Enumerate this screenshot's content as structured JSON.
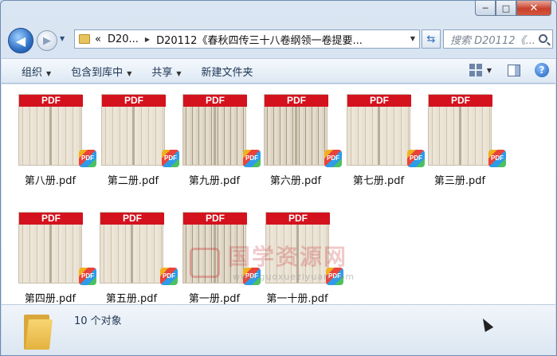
{
  "window": {
    "min_label": "─",
    "max_label": "□",
    "close_label": "✕"
  },
  "nav": {
    "back_glyph": "◀",
    "forward_glyph": "▶",
    "dropdown_glyph": "▼",
    "breadcrumb": [
      "«",
      "D20...",
      "D20112《春秋四传三十八卷纲领一卷提要..."
    ],
    "refresh_glyph": "⇆",
    "search_placeholder": "搜索 D20112《..."
  },
  "toolbar": {
    "items": [
      "组织",
      "包含到库中",
      "共享",
      "新建文件夹"
    ],
    "caret": "▼",
    "help_label": "?"
  },
  "files": [
    {
      "name": "第八册.pdf",
      "band": "PDF",
      "badge": "PDF"
    },
    {
      "name": "第二册.pdf",
      "band": "PDF",
      "badge": "PDF"
    },
    {
      "name": "第九册.pdf",
      "band": "PDF",
      "badge": "PDF"
    },
    {
      "name": "第六册.pdf",
      "band": "PDF",
      "badge": "PDF"
    },
    {
      "name": "第七册.pdf",
      "band": "PDF",
      "badge": "PDF"
    },
    {
      "name": "第三册.pdf",
      "band": "PDF",
      "badge": "PDF"
    },
    {
      "name": "第四册.pdf",
      "band": "PDF",
      "badge": "PDF"
    },
    {
      "name": "第五册.pdf",
      "band": "PDF",
      "badge": "PDF"
    },
    {
      "name": "第一册.pdf",
      "band": "PDF",
      "badge": "PDF"
    },
    {
      "name": "第一十册.pdf",
      "band": "PDF",
      "badge": "PDF"
    }
  ],
  "watermark": {
    "text": "国学资源网",
    "url": "www.guoxueziyuan.com"
  },
  "status": {
    "count_text": "10 个对象"
  }
}
